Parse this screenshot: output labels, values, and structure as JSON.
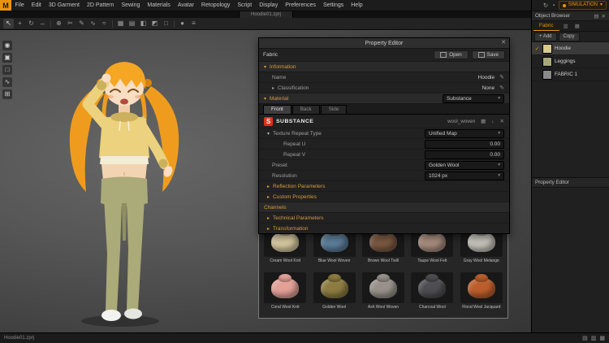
{
  "menubar": {
    "logo": "M",
    "items": [
      "File",
      "Edit",
      "3D Garment",
      "2D Pattern",
      "Sewing",
      "Materials",
      "Avatar",
      "Retopology",
      "Script",
      "Display",
      "Preferences",
      "Settings",
      "Help"
    ]
  },
  "simulation": {
    "sync_glyph": "↻",
    "account_glyph": "◔",
    "label": "SIMULATION",
    "caret": "▾"
  },
  "document_tab": {
    "label": "Hoodie01.zprj"
  },
  "toolbar": {
    "icons": [
      {
        "name": "select-move-tool",
        "glyph": "↖"
      },
      {
        "name": "transform-gizmo-tool",
        "glyph": "+"
      },
      {
        "name": "rotate-view-tool",
        "glyph": "↻"
      },
      {
        "name": "pan-view-tool",
        "glyph": "↔"
      },
      {
        "name": "zoom-tool",
        "glyph": "⊕"
      },
      {
        "name": "scissors-tool",
        "glyph": "✂"
      },
      {
        "name": "edit-sewing-tool",
        "glyph": "✎"
      },
      {
        "name": "free-sewing-tool",
        "glyph": "∿"
      },
      {
        "name": "segment-sewing-tool",
        "glyph": "≈"
      },
      {
        "name": "show-grid-toggle",
        "glyph": "▦"
      },
      {
        "name": "arrangement-points-toggle",
        "glyph": "▤"
      },
      {
        "name": "half-symmetry-toggle",
        "glyph": "◧"
      },
      {
        "name": "mesh-display-toggle",
        "glyph": "◩"
      },
      {
        "name": "pattern-outline-toggle",
        "glyph": "□"
      },
      {
        "name": "simulate-button",
        "glyph": "●"
      },
      {
        "name": "view-options-menu",
        "glyph": "≡"
      }
    ]
  },
  "viewport_tools": {
    "icons": [
      {
        "name": "show-avatar-toggle",
        "glyph": "◉"
      },
      {
        "name": "show-garment-toggle",
        "glyph": "▣"
      },
      {
        "name": "show-pattern-toggle",
        "glyph": "□"
      },
      {
        "name": "show-seams-toggle",
        "glyph": "∿"
      },
      {
        "name": "show-grid-toggle",
        "glyph": "⊞"
      }
    ]
  },
  "property_editor": {
    "title": "Property Editor",
    "close_glyph": "✕",
    "fabric_label": "Fabric",
    "open_label": "Open",
    "save_label": "Save",
    "expand_open": "▾",
    "expand_closed": "▸",
    "edit_glyph": "✎",
    "caret": "▾",
    "info_section": "Information",
    "name_label": "Name",
    "name_value": "Hoodie",
    "class_label": "Classification",
    "class_value": "None",
    "material_section": "Material",
    "material_type": "Substance",
    "tabs": [
      "Front",
      "Back",
      "Side"
    ],
    "substance_brand": "SUBSTANCE",
    "substance_file": "wool_woven",
    "substance_icons": [
      {
        "name": "texture-icon",
        "glyph": "▦"
      },
      {
        "name": "import-icon",
        "glyph": "↓"
      },
      {
        "name": "remove-icon",
        "glyph": "✕"
      }
    ],
    "texture_repeat_label": "Texture Repeat Type",
    "texture_repeat_value": "Unified Map",
    "repeat_u_label": "Repeat U",
    "repeat_u_value": "0.00",
    "repeat_v_label": "Repeat V",
    "repeat_v_value": "0.00",
    "preset_label": "Preset",
    "preset_value": "Golden Wool",
    "resolution_label": "Resolution",
    "resolution_value": "1024 px",
    "reflection_section": "Reflection Parameters",
    "custom_section": "Custom Properties",
    "channels_section": "Channels",
    "technical_section": "Technical Parameters",
    "transform_section": "Transformation"
  },
  "gallery": {
    "items": [
      {
        "label": "Cream Wool Knit",
        "color": "#d6c9a0"
      },
      {
        "label": "Blue Wool Woven",
        "color": "#5d7f9b"
      },
      {
        "label": "Brown Wool Twill",
        "color": "#7c5a42"
      },
      {
        "label": "Taupe Wool Felt",
        "color": "#a88d7e"
      },
      {
        "label": "Gray Wool Melange",
        "color": "#c6c3ba"
      },
      {
        "label": "Coral Wool Knit",
        "color": "#e2a097"
      },
      {
        "label": "Golden Wool",
        "color": "#8d7c41"
      },
      {
        "label": "Ash Wool Woven",
        "color": "#97918a"
      },
      {
        "label": "Charcoal Wool",
        "color": "#4e4e52"
      },
      {
        "label": "Floral Wool Jacquard",
        "color": "#bc5e2c"
      }
    ]
  },
  "object_browser": {
    "title": "Object Browser",
    "menu_glyph": "▤",
    "close_glyph": "✕",
    "tab": "Fabric",
    "tab_icon_1": "▥",
    "tab_icon_2": "▦",
    "add_label": "+ Add",
    "copy_label": "Copy",
    "check_glyph": "✓",
    "items": [
      {
        "name": "Hoodie",
        "color": "#d8c98f"
      },
      {
        "name": "Leggings",
        "color": "#a7a77b"
      },
      {
        "name": "FABRIC 1",
        "color": "#8a8a8a"
      }
    ],
    "lower_panel_title": "Property Editor"
  },
  "status_bar": {
    "left": "Hoodie01.zprj",
    "icons": [
      {
        "name": "layout-grid-icon",
        "glyph": "▤"
      },
      {
        "name": "layout-split-icon",
        "glyph": "▥"
      },
      {
        "name": "layout-full-icon",
        "glyph": "▦"
      }
    ]
  },
  "colors": {
    "accent": "#e8950c",
    "substance_red": "#e0301e"
  }
}
